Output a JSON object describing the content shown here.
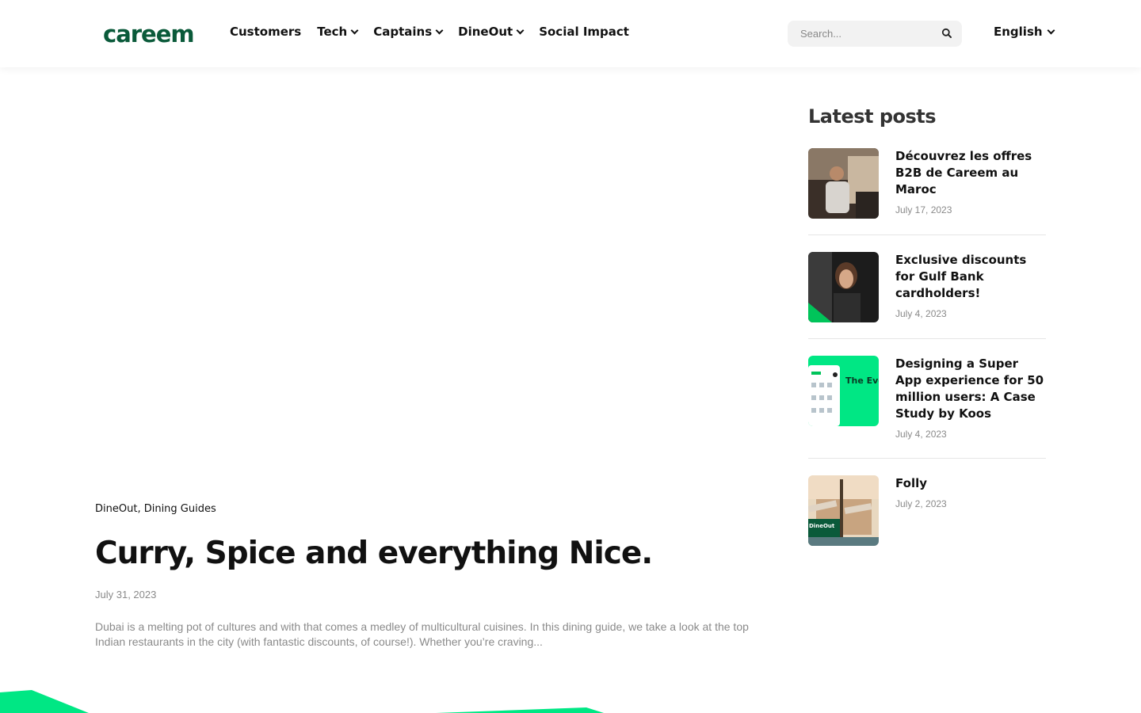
{
  "header": {
    "logo_text": "careem",
    "nav": [
      {
        "label": "Customers",
        "has_dropdown": false
      },
      {
        "label": "Tech",
        "has_dropdown": true
      },
      {
        "label": "Captains",
        "has_dropdown": true
      },
      {
        "label": "DineOut",
        "has_dropdown": true
      },
      {
        "label": "Social Impact",
        "has_dropdown": false
      }
    ],
    "search_placeholder": "Search...",
    "search_icon": "search-icon",
    "language": "English"
  },
  "article": {
    "categories": [
      "DineOut",
      "Dining Guides"
    ],
    "category_separator": ", ",
    "title": "Curry, Spice and everything Nice.",
    "date": "July 31, 2023",
    "excerpt": "Dubai is a melting pot of cultures and with that comes a medley of multicultural cuisines. In this dining guide, we take a look at the top Indian restaurants in the city (with fantastic discounts, of course!). Whether you’re craving..."
  },
  "sidebar": {
    "title": "Latest posts",
    "posts": [
      {
        "title": "Découvrez les offres B2B de Careem au Maroc",
        "date": "July 17, 2023"
      },
      {
        "title": "Exclusive discounts for Gulf Bank cardholders!",
        "date": "July 4, 2023"
      },
      {
        "title": "Designing a Super App experience for 50 million users: A Case Study by Koos",
        "date": "July 4, 2023",
        "thumb_text": "The Everyth App."
      },
      {
        "title": "Folly",
        "date": "July 2, 2023",
        "thumb_text": "DineOut"
      }
    ]
  },
  "colors": {
    "brand_green": "#00e784",
    "logo_green": "#0a5a3a",
    "text": "#111111",
    "muted": "#8a8a8a"
  }
}
